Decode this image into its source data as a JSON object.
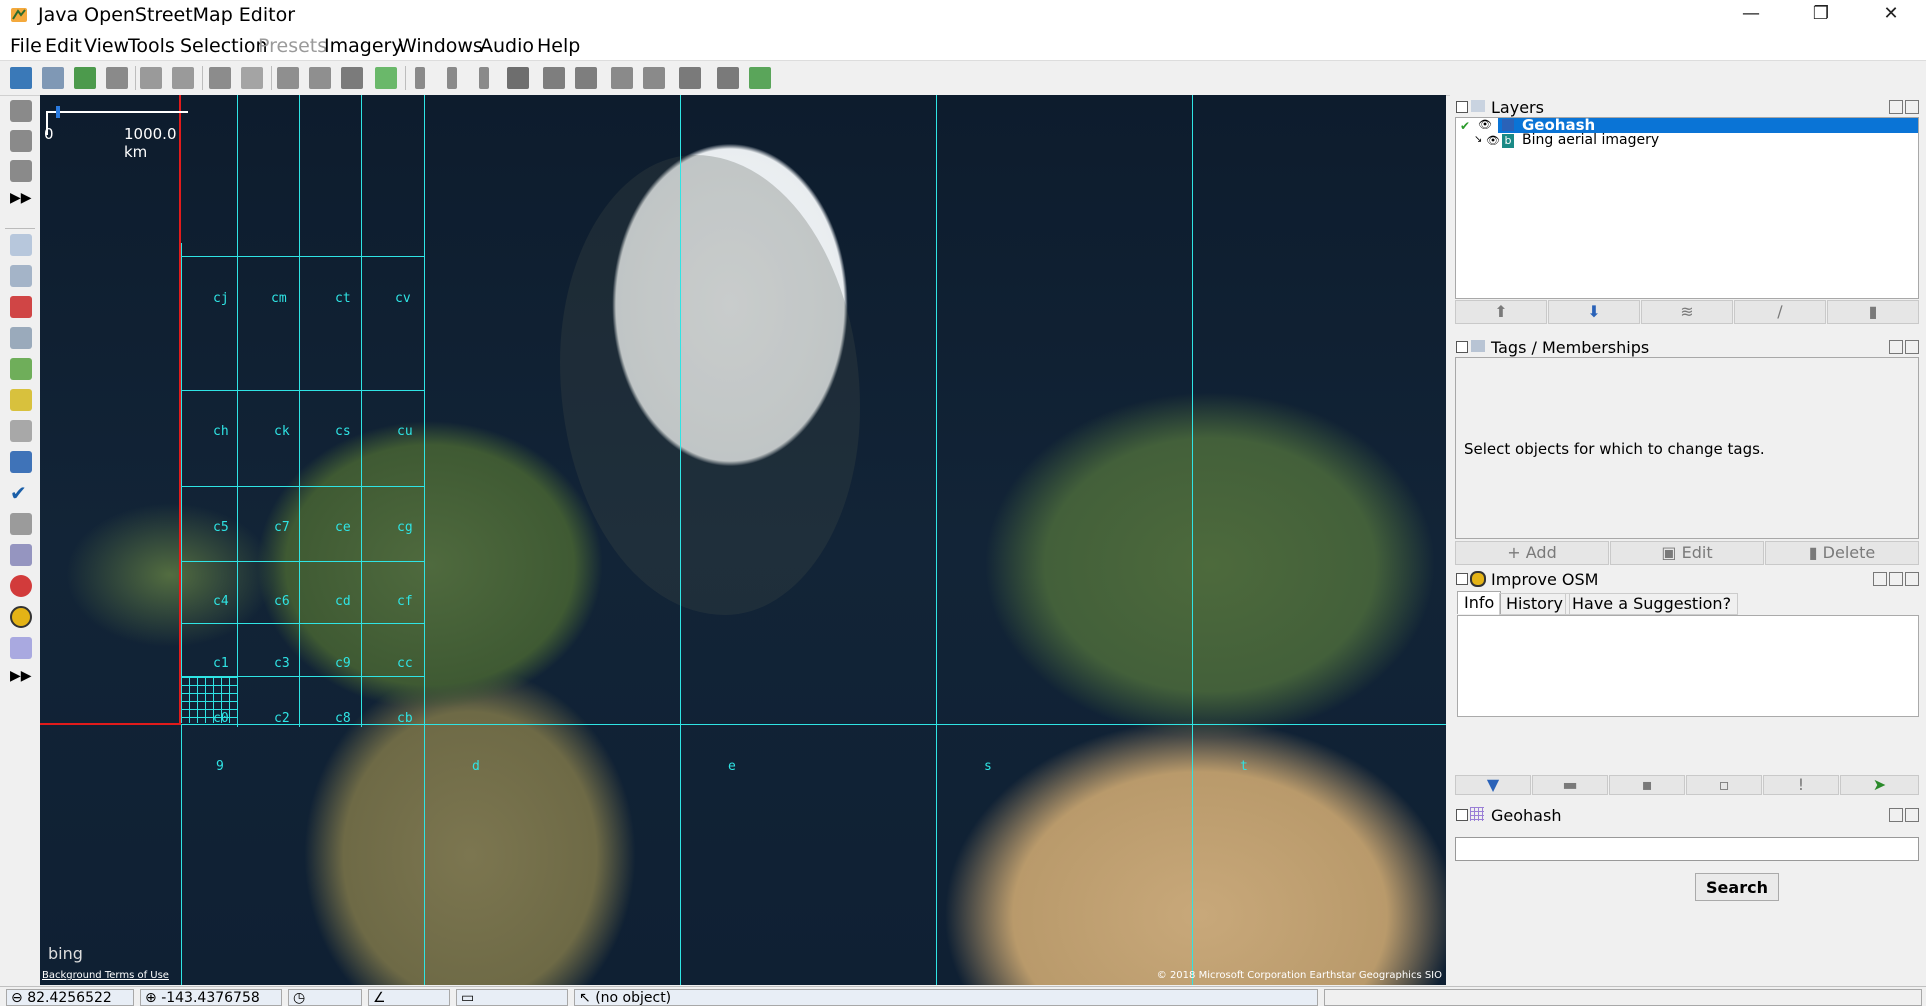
{
  "window": {
    "title": "Java OpenStreetMap Editor",
    "minimize": "—",
    "restore": "❐",
    "close": "✕"
  },
  "menu": [
    {
      "label": "File",
      "enabled": true
    },
    {
      "label": "Edit",
      "enabled": true
    },
    {
      "label": "View",
      "enabled": true
    },
    {
      "label": "Tools",
      "enabled": true
    },
    {
      "label": "Selection",
      "enabled": true
    },
    {
      "label": "Presets",
      "enabled": false
    },
    {
      "label": "Imagery",
      "enabled": true
    },
    {
      "label": "Windows",
      "enabled": true
    },
    {
      "label": "Audio",
      "enabled": true
    },
    {
      "label": "Help",
      "enabled": true
    }
  ],
  "toolbar": {
    "buttons": [
      "open-icon",
      "open-location-icon",
      "save-icon",
      "upload-icon",
      "undo-icon",
      "redo-icon",
      "preferences-icon",
      "info-icon",
      "merge-icon",
      "split-icon",
      "refresh-icon",
      "zoom-to-data-icon",
      "pin-icon",
      "pin2-icon",
      "pin3-icon",
      "tile-icon",
      "bus-icon",
      "bus2-icon",
      "parking-icon",
      "hydrant-icon",
      "castle-icon",
      "factory-icon",
      "download-data-icon"
    ]
  },
  "left_tools": [
    "select-tool-icon",
    "draw-tool-icon",
    "improve-way-tool-icon",
    "more-tools-icon",
    "layers-toggle-icon",
    "tags-toggle-icon",
    "relations-toggle-icon",
    "selection-list-icon",
    "history-icon",
    "conflict-icon",
    "filter-icon",
    "validation-icon",
    "changeset-icon",
    "map-paint-icon",
    "notes-icon",
    "improve-osm-icon",
    "geohash-icon",
    "more-toggles-icon"
  ],
  "map": {
    "scale": {
      "start": "0",
      "end": "1000.0 km"
    },
    "bing_logo": "bing",
    "terms": "Background Terms of Use",
    "attribution": "© 2018 Microsoft Corporation Earthstar Geographics  SIO",
    "geohash_cells": [
      {
        "label": "cj"
      },
      {
        "label": "cm"
      },
      {
        "label": "ct"
      },
      {
        "label": "cv"
      },
      {
        "label": "ch"
      },
      {
        "label": "ck"
      },
      {
        "label": "cs"
      },
      {
        "label": "cu"
      },
      {
        "label": "c5"
      },
      {
        "label": "c7"
      },
      {
        "label": "ce"
      },
      {
        "label": "cg"
      },
      {
        "label": "c4"
      },
      {
        "label": "c6"
      },
      {
        "label": "cd"
      },
      {
        "label": "cf"
      },
      {
        "label": "c1"
      },
      {
        "label": "c3"
      },
      {
        "label": "c9"
      },
      {
        "label": "cc"
      },
      {
        "label": "c0"
      },
      {
        "label": "c2"
      },
      {
        "label": "c8"
      },
      {
        "label": "cb"
      },
      {
        "label": "9"
      },
      {
        "label": "d"
      },
      {
        "label": "e"
      },
      {
        "label": "s"
      },
      {
        "label": "t"
      }
    ]
  },
  "layers_panel": {
    "title": "Layers",
    "layers": [
      {
        "name": "Geohash",
        "selected": true,
        "visible": true
      },
      {
        "name": "Bing aerial imagery",
        "selected": false,
        "visible": true
      }
    ]
  },
  "tags_panel": {
    "title": "Tags / Memberships",
    "empty_text": "Select objects for which to change tags.",
    "add": "Add",
    "edit": "Edit",
    "delete": "Delete"
  },
  "improve_osm_panel": {
    "title": "Improve OSM",
    "tabs": [
      "Info",
      "History",
      "Have a Suggestion?"
    ]
  },
  "geohash_panel": {
    "title": "Geohash",
    "input_value": "",
    "search_label": "Search"
  },
  "status": {
    "lat": "82.4256522",
    "lon": "-143.4376758",
    "object": "(no object)"
  },
  "colors": {
    "grid": "#2fe4e4",
    "grid_selected": "#e21b1b",
    "selection": "#0a74d6"
  }
}
